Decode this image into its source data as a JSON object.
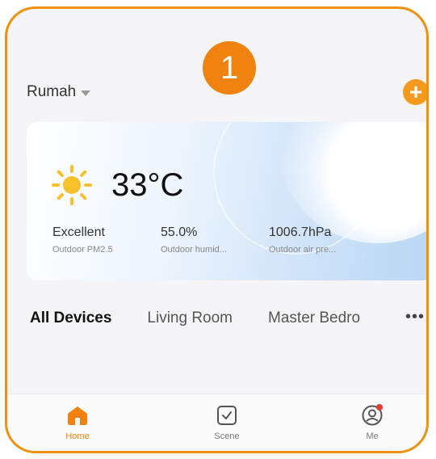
{
  "step_number": "1",
  "header": {
    "home_name": "Rumah"
  },
  "weather": {
    "temperature": "33°C",
    "metrics": [
      {
        "value": "Excellent",
        "label": "Outdoor PM2.5"
      },
      {
        "value": "55.0%",
        "label": "Outdoor humid..."
      },
      {
        "value": "1006.7hPa",
        "label": "Outdoor air pre..."
      }
    ]
  },
  "tabs": [
    "All Devices",
    "Living Room",
    "Master Bedro"
  ],
  "more_label": "•••",
  "tabbar": {
    "items": [
      {
        "label": "Home",
        "icon": "home-icon",
        "active": true
      },
      {
        "label": "Scene",
        "icon": "scene-checkbox-icon",
        "active": false
      },
      {
        "label": "Me",
        "icon": "profile-icon",
        "active": false
      }
    ]
  },
  "colors": {
    "accent": "#f0820f",
    "notification_dot": "#e53935"
  }
}
